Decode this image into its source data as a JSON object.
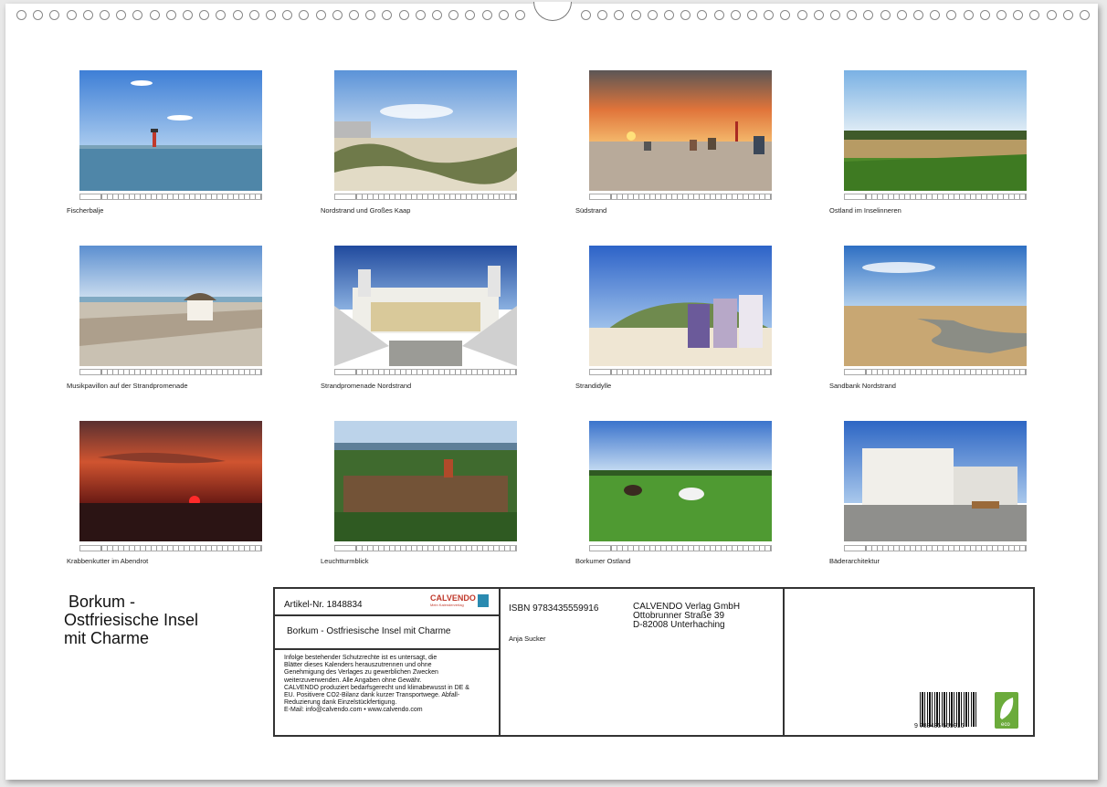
{
  "photos": [
    {
      "caption": "Fischerbalje"
    },
    {
      "caption": "Nordstrand und Großes Kaap"
    },
    {
      "caption": "Südstrand"
    },
    {
      "caption": "Ostland im Inselinneren"
    },
    {
      "caption": "Musikpavillon auf der Strandpromenade"
    },
    {
      "caption": "Strandpromenade Nordstrand"
    },
    {
      "caption": "Strandidylle"
    },
    {
      "caption": "Sandbank Nordstrand"
    },
    {
      "caption": "Krabbenkutter im Abendrot"
    },
    {
      "caption": "Leuchtturmblick"
    },
    {
      "caption": "Borkumer Ostland"
    },
    {
      "caption": "Bäderarchitektur"
    }
  ],
  "calendar": {
    "title_lines": [
      " Borkum -",
      "Ostfriesische Insel",
      "mit Charme"
    ]
  },
  "info": {
    "article": "Artikel-Nr. 1848834",
    "brand": "CALVENDO",
    "brand_sub": "Mein Kalenderverlag",
    "product_title": "Borkum - Ostfriesische Insel mit Charme",
    "legal": "Infolge bestehender Schutzrechte ist es untersagt, die\nBlätter dieses Kalenders herauszutrennen und ohne\nGenehmigung des Verlages zu gewerblichen Zwecken\nweiterzuverwenden. Alle Angaben ohne Gewähr.\nCALVENDO produziert bedarfsgerecht und klimabewusst in DE &\nEU. Positivere CO2-Bilanz dank kurzer Transportwege. Abfall-\nReduzierung dank Einzelstückfertigung.\nE-Mail: info@calvendo.com • www.calvendo.com",
    "isbn": "ISBN 9783435559916",
    "author": "Anja Sucker",
    "publisher_lines": [
      "CALVENDO Verlag GmbH",
      "Ottobrunner Straße 39",
      "D-82008 Unterhaching"
    ],
    "barcode_number": "9 783435 559916",
    "eco_label": "eco"
  },
  "colors": {
    "frame": "#333333",
    "page": "#ffffff",
    "eco": "#6bab3b",
    "brand": "#c0392b"
  }
}
